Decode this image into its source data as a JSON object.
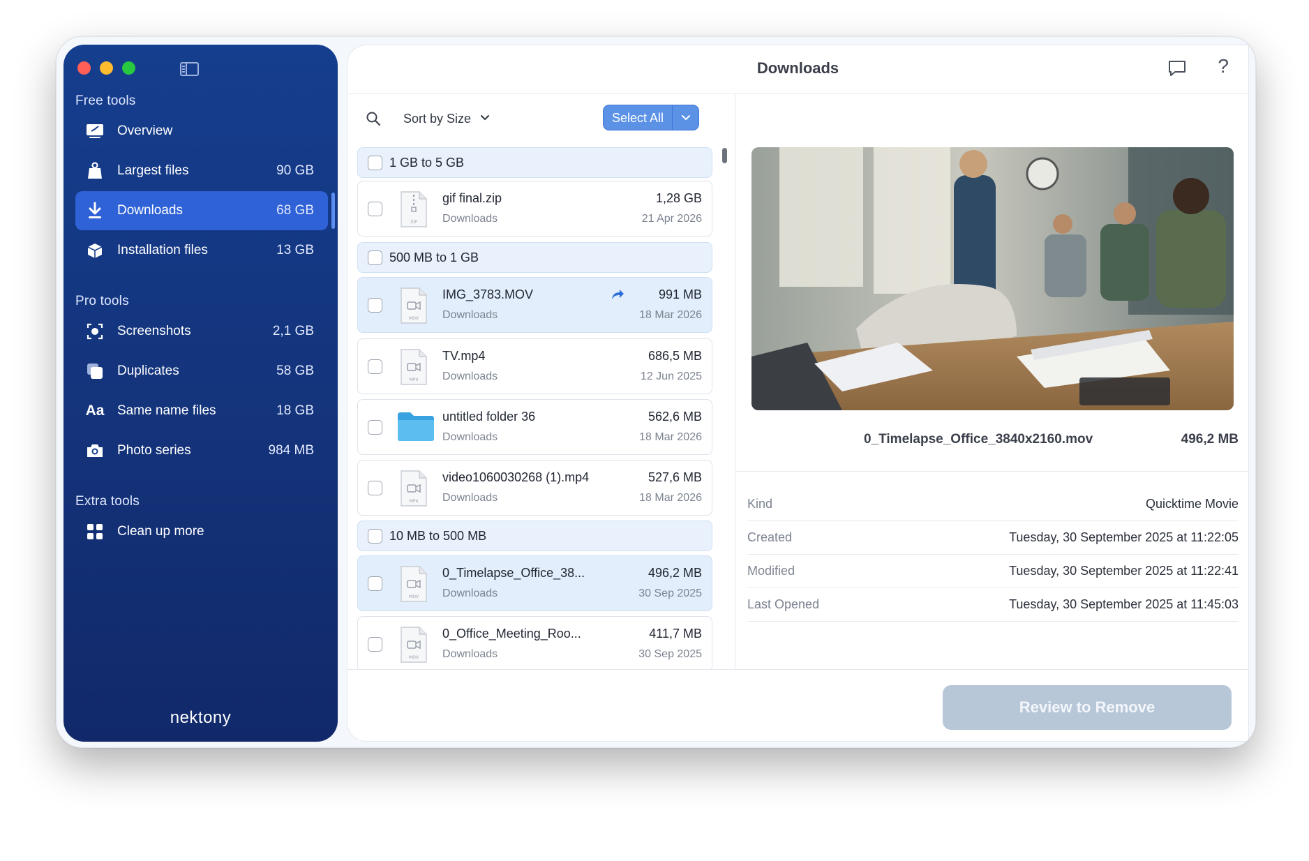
{
  "sidebar": {
    "sections": {
      "free": "Free tools",
      "pro": "Pro tools",
      "extra": "Extra tools"
    },
    "items": [
      {
        "label": "Overview",
        "size": "",
        "icon": "overview-icon"
      },
      {
        "label": "Largest files",
        "size": "90 GB",
        "icon": "weight-icon"
      },
      {
        "label": "Downloads",
        "size": "68 GB",
        "icon": "download-icon",
        "active": true
      },
      {
        "label": "Installation files",
        "size": "13 GB",
        "icon": "package-icon"
      },
      {
        "label": "Screenshots",
        "size": "2,1 GB",
        "icon": "screenshot-icon"
      },
      {
        "label": "Duplicates",
        "size": "58 GB",
        "icon": "duplicates-icon"
      },
      {
        "label": "Same name files",
        "size": "18 GB",
        "icon": "text-aa-icon"
      },
      {
        "label": "Photo series",
        "size": "984 MB",
        "icon": "camera-icon"
      },
      {
        "label": "Clean up more",
        "size": "",
        "icon": "grid-icon"
      }
    ],
    "brand": "nektony"
  },
  "header": {
    "title": "Downloads"
  },
  "toolbar": {
    "sort_label": "Sort by Size",
    "select_all": "Select All"
  },
  "groups": [
    {
      "label": "1 GB to 5 GB"
    },
    {
      "label": "500 MB to 1 GB"
    },
    {
      "label": "10 MB to 500 MB"
    }
  ],
  "files": [
    {
      "name": "gif final.zip",
      "location": "Downloads",
      "size": "1,28 GB",
      "date": "21 Apr 2026",
      "type_badge": "ZIP"
    },
    {
      "name": "IMG_3783.MOV",
      "location": "Downloads",
      "size": "991 MB",
      "date": "18 Mar 2026",
      "type_badge": "MOV"
    },
    {
      "name": "TV.mp4",
      "location": "Downloads",
      "size": "686,5 MB",
      "date": "12 Jun 2025",
      "type_badge": "MP4"
    },
    {
      "name": "untitled folder 36",
      "location": "Downloads",
      "size": "562,6 MB",
      "date": "18 Mar 2026",
      "type_badge": ""
    },
    {
      "name": "video1060030268 (1).mp4",
      "location": "Downloads",
      "size": "527,6 MB",
      "date": "18 Mar 2026",
      "type_badge": "MP4"
    },
    {
      "name": "0_Timelapse_Office_38...",
      "location": "Downloads",
      "size": "496,2 MB",
      "date": "30 Sep 2025",
      "type_badge": "MOV"
    },
    {
      "name": "0_Office_Meeting_Roo...",
      "location": "Downloads",
      "size": "411,7 MB",
      "date": "30 Sep 2025",
      "type_badge": "MOV"
    }
  ],
  "preview": {
    "name": "0_Timelapse_Office_3840x2160.mov",
    "size": "496,2 MB",
    "info": [
      {
        "key": "Kind",
        "value": "Quicktime Movie"
      },
      {
        "key": "Created",
        "value": "Tuesday, 30 September 2025 at 11:22:05"
      },
      {
        "key": "Modified",
        "value": "Tuesday, 30 September 2025 at 11:22:41"
      },
      {
        "key": "Last Opened",
        "value": "Tuesday, 30 September 2025 at 11:45:03"
      }
    ]
  },
  "footer": {
    "review_button": "Review to Remove"
  },
  "colors": {
    "sidebar_bg": "#14337a",
    "active_item": "#2f62d6",
    "accent": "#5b92e6",
    "review_button_disabled": "#b7c7d8"
  }
}
